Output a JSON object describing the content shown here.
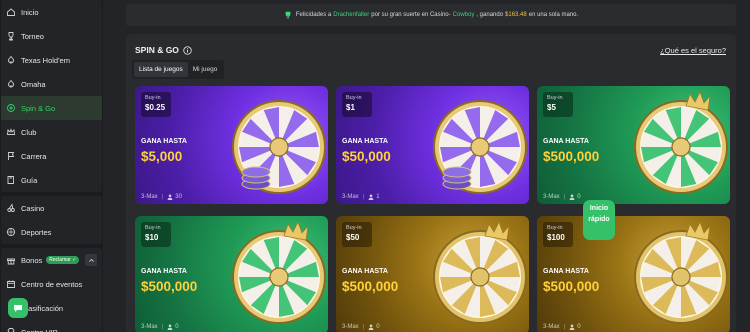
{
  "sidebar": {
    "groups": [
      [
        {
          "label": "Inicio",
          "icon": "home-icon"
        },
        {
          "label": "Torneo",
          "icon": "trophy-icon"
        },
        {
          "label": "Texas Hold'em",
          "icon": "spade-icon"
        },
        {
          "label": "Omaha",
          "icon": "spade-icon"
        },
        {
          "label": "Spin & Go",
          "icon": "spin-icon",
          "active": true
        },
        {
          "label": "Club",
          "icon": "crown-icon"
        },
        {
          "label": "Carrera",
          "icon": "flag-icon"
        },
        {
          "label": "Guía",
          "icon": "book-icon"
        }
      ],
      [
        {
          "label": "Casino",
          "icon": "cherry-icon"
        },
        {
          "label": "Deportes",
          "icon": "ball-icon"
        }
      ],
      [
        {
          "label": "Bonos",
          "icon": "gift-icon",
          "badge": "Reclamar ✓"
        },
        {
          "label": "Centro de eventos",
          "icon": "calendar-icon"
        },
        {
          "label": "Clasificación",
          "icon": "trophy-icon"
        },
        {
          "label": "Centro VIP",
          "icon": "diamond-icon"
        }
      ]
    ]
  },
  "notice": {
    "pre": "Felicidades a",
    "user": "Drachenfalter",
    "mid": "por su gran suerte en Casino-",
    "game": "Cowboy",
    "post": ", ganando",
    "amount": "$163.48",
    "end": "en una sola mano."
  },
  "panel": {
    "title": "SPIN & GO",
    "safe_link": "¿Qué es el seguro?",
    "tabs": [
      "Lista de juegos",
      "Mi juego"
    ]
  },
  "cards": [
    {
      "theme": "purple",
      "buyin_label": "Buy-in",
      "buyin": "$0.25",
      "gana": "GANA HASTA",
      "prize": "$5,000",
      "format": "3-Max",
      "players": "30"
    },
    {
      "theme": "purple",
      "buyin_label": "Buy-in",
      "buyin": "$1",
      "gana": "GANA HASTA",
      "prize": "$50,000",
      "format": "3-Max",
      "players": "1"
    },
    {
      "theme": "green",
      "buyin_label": "Buy-in",
      "buyin": "$5",
      "gana": "GANA HASTA",
      "prize": "$500,000",
      "format": "3-Max",
      "players": "0"
    },
    {
      "theme": "green",
      "buyin_label": "Buy-in",
      "buyin": "$10",
      "gana": "GANA HASTA",
      "prize": "$500,000",
      "format": "3-Max",
      "players": "0"
    },
    {
      "theme": "gold",
      "buyin_label": "Buy-in",
      "buyin": "$50",
      "gana": "GANA HASTA",
      "prize": "$500,000",
      "format": "3-Max",
      "players": "0"
    },
    {
      "theme": "gold",
      "buyin_label": "Buy-in",
      "buyin": "$100",
      "gana": "GANA HASTA",
      "prize": "$500,000",
      "format": "3-Max",
      "players": "0"
    }
  ],
  "quick_start": "Inicio rápido",
  "colors": {
    "accent": "#35c06a",
    "prize": "#ffd13b"
  }
}
